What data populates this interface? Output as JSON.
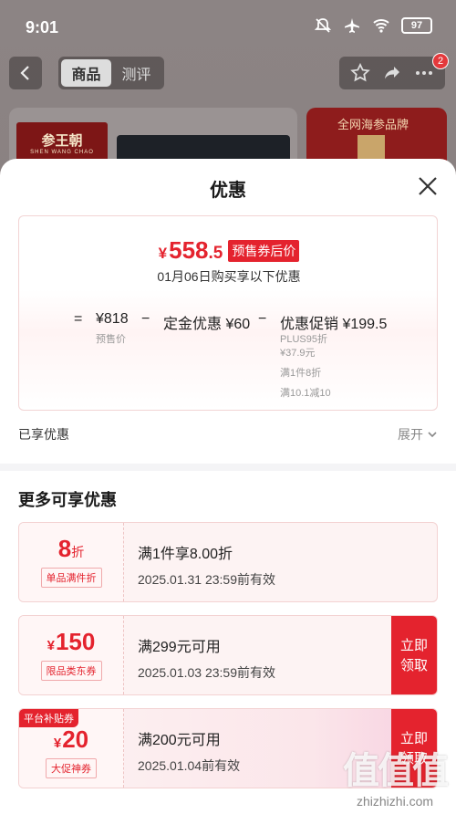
{
  "status_bar": {
    "time": "9:01",
    "battery": "97"
  },
  "top_nav": {
    "tabs": [
      {
        "label": "商品",
        "active": true
      },
      {
        "label": "测评",
        "active": false
      }
    ],
    "message_badge": "2"
  },
  "background": {
    "brand_name": "参王朝",
    "brand_sub": "SHEN WANG CHAO",
    "banner_text": "全网海参品牌"
  },
  "sheet": {
    "title": "优惠",
    "price": {
      "currency": "¥",
      "integer": "558",
      "decimal": ".5",
      "tag": "预售券后价",
      "subtitle": "01月06日购买享以下优惠"
    },
    "formula": {
      "equals": "=",
      "base_price": "¥818",
      "base_label": "预售价",
      "minus1": "−",
      "deposit": "定金优惠 ¥60",
      "minus2": "−",
      "promo": "优惠促销 ¥199.5",
      "promo_lines": [
        "PLUS95折",
        "¥37.9元",
        "满1件8折",
        "满10.1减10"
      ]
    },
    "enjoyed_label": "已享优惠",
    "expand_label": "展开",
    "more_title": "更多可享优惠",
    "coupons": [
      {
        "value": "8",
        "unit": "折",
        "currency": "",
        "type": "单品满件折",
        "condition": "满1件享8.00折",
        "valid": "2025.01.31 23:59前有效",
        "claim": "",
        "corner_tag": ""
      },
      {
        "value": "150",
        "unit": "",
        "currency": "¥",
        "type": "限品类东券",
        "condition": "满299元可用",
        "valid": "2025.01.03 23:59前有效",
        "claim": [
          "立即",
          "领取"
        ],
        "corner_tag": ""
      },
      {
        "value": "20",
        "unit": "",
        "currency": "¥",
        "type": "大促神券",
        "condition": "满200元可用",
        "valid": "2025.01.04前有效",
        "claim": [
          "立即",
          "领取"
        ],
        "corner_tag": "平台补贴券"
      }
    ]
  },
  "watermark": {
    "glyphs": "值值值",
    "url": "zhizhizhi.com"
  },
  "colors": {
    "accent": "#e4232e",
    "sheet_bg": "#ffffff",
    "overlay": "#857b7b"
  }
}
